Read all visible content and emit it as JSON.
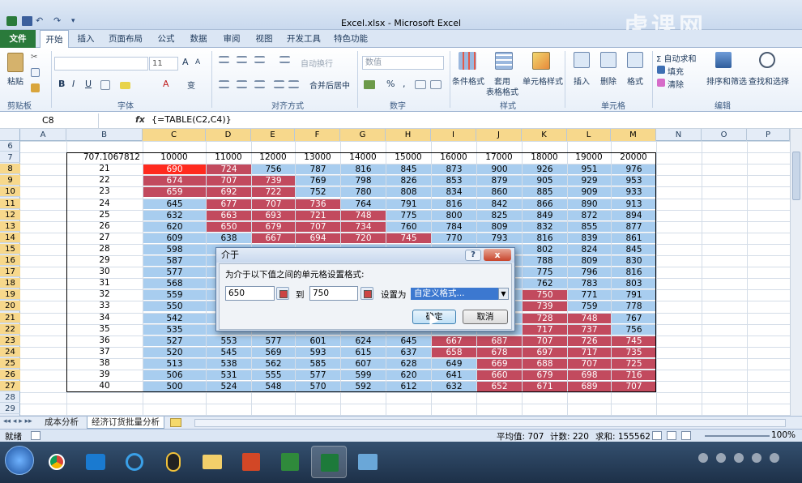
{
  "window": {
    "title": "Excel.xlsx - Microsoft Excel",
    "watermark": "虎课网"
  },
  "tabs": [
    "文件",
    "开始",
    "插入",
    "页面布局",
    "公式",
    "数据",
    "审阅",
    "视图",
    "开发工具",
    "特色功能"
  ],
  "ribbon": {
    "clipboard": {
      "paste": "粘贴",
      "label": "剪贴板"
    },
    "font": {
      "size": "11",
      "label": "字体",
      "bold": "B",
      "italic": "I",
      "underline": "U",
      "grow": "A",
      "shrink": "A",
      "color": "A",
      "phonetic": "变"
    },
    "alignment": {
      "wrap": "自动换行",
      "merge": "合并后居中",
      "label": "对齐方式"
    },
    "number": {
      "format": "数值",
      "label": "数字",
      "percent": "%",
      "comma": ","
    },
    "styles": {
      "conditional": "条件格式",
      "table": "套用",
      "table2": "表格格式",
      "cell_styles": "单元格样式",
      "label": "样式"
    },
    "cells": {
      "insert": "插入",
      "delete": "删除",
      "format": "格式",
      "label": "单元格"
    },
    "editing": {
      "autosum": "Σ 自动求和",
      "fill": "填充",
      "clear": "清除",
      "sort": "排序和筛选",
      "find": "查找和选择",
      "label": "编辑"
    }
  },
  "formula_bar": {
    "name_box": "C8",
    "fx": "fx",
    "formula": "{=TABLE(C2,C4)}"
  },
  "columns": [
    "A",
    "B",
    "C",
    "D",
    "E",
    "F",
    "G",
    "H",
    "I",
    "J",
    "K",
    "L",
    "M",
    "N",
    "O",
    "P"
  ],
  "rows": [
    "6",
    "7",
    "8",
    "9",
    "10",
    "11",
    "12",
    "13",
    "14",
    "15",
    "16",
    "17",
    "18",
    "19",
    "20",
    "21",
    "22",
    "23",
    "24",
    "25",
    "26",
    "27",
    "28",
    "29"
  ],
  "table": {
    "corner": "707.1067812",
    "col_headers": [
      "10000",
      "11000",
      "12000",
      "13000",
      "14000",
      "15000",
      "16000",
      "17000",
      "18000",
      "19000",
      "20000"
    ],
    "row_headers": [
      "21",
      "22",
      "23",
      "24",
      "25",
      "26",
      "27",
      "28",
      "29",
      "30",
      "31",
      "32",
      "33",
      "34",
      "35",
      "36",
      "37",
      "38",
      "39",
      "40"
    ],
    "values": [
      [
        "690",
        "724",
        "756",
        "787",
        "816",
        "845",
        "873",
        "900",
        "926",
        "951",
        "976"
      ],
      [
        "674",
        "707",
        "739",
        "769",
        "798",
        "826",
        "853",
        "879",
        "905",
        "929",
        "953"
      ],
      [
        "659",
        "692",
        "722",
        "752",
        "780",
        "808",
        "834",
        "860",
        "885",
        "909",
        "933"
      ],
      [
        "645",
        "677",
        "707",
        "736",
        "764",
        "791",
        "816",
        "842",
        "866",
        "890",
        "913"
      ],
      [
        "632",
        "663",
        "693",
        "721",
        "748",
        "775",
        "800",
        "825",
        "849",
        "872",
        "894"
      ],
      [
        "620",
        "650",
        "679",
        "707",
        "734",
        "760",
        "784",
        "809",
        "832",
        "855",
        "877"
      ],
      [
        "609",
        "638",
        "667",
        "694",
        "720",
        "745",
        "770",
        "793",
        "816",
        "839",
        "861"
      ],
      [
        "598",
        "",
        "",
        "",
        "",
        "",
        "",
        "",
        "802",
        "824",
        "845"
      ],
      [
        "587",
        "",
        "",
        "",
        "",
        "",
        "",
        "",
        "788",
        "809",
        "830"
      ],
      [
        "577",
        "",
        "",
        "",
        "",
        "",
        "",
        "",
        "775",
        "796",
        "816"
      ],
      [
        "568",
        "",
        "",
        "",
        "",
        "",
        "",
        "",
        "762",
        "783",
        "803"
      ],
      [
        "559",
        "",
        "",
        "",
        "",
        "",
        "",
        "",
        "750",
        "771",
        "791"
      ],
      [
        "550",
        "",
        "",
        "",
        "",
        "",
        "",
        "",
        "739",
        "759",
        "778"
      ],
      [
        "542",
        "",
        "",
        "",
        "",
        "",
        "",
        "",
        "728",
        "748",
        "767"
      ],
      [
        "535",
        "",
        "",
        "",
        "",
        "",
        "",
        "",
        "717",
        "737",
        "756"
      ],
      [
        "527",
        "553",
        "577",
        "601",
        "624",
        "645",
        "667",
        "687",
        "707",
        "726",
        "745"
      ],
      [
        "520",
        "545",
        "569",
        "593",
        "615",
        "637",
        "658",
        "678",
        "697",
        "717",
        "735"
      ],
      [
        "513",
        "538",
        "562",
        "585",
        "607",
        "628",
        "649",
        "669",
        "688",
        "707",
        "725"
      ],
      [
        "506",
        "531",
        "555",
        "577",
        "599",
        "620",
        "641",
        "660",
        "679",
        "698",
        "716"
      ],
      [
        "500",
        "524",
        "548",
        "570",
        "592",
        "612",
        "632",
        "652",
        "671",
        "689",
        "707"
      ]
    ]
  },
  "sheets": [
    "成本分析",
    "经济订货批量分析"
  ],
  "status": {
    "ready": "就绪",
    "average": "平均值: 707",
    "count": "计数: 220",
    "sum": "求和: 155562",
    "zoom": "100%"
  },
  "dialog": {
    "title": "介于",
    "prompt": "为介于以下值之间的单元格设置格式:",
    "from": "650",
    "to_label": "到",
    "to": "750",
    "set_label": "设置为",
    "format": "自定义格式...",
    "ok": "确定",
    "cancel": "取消",
    "help": "?",
    "close": "x"
  }
}
